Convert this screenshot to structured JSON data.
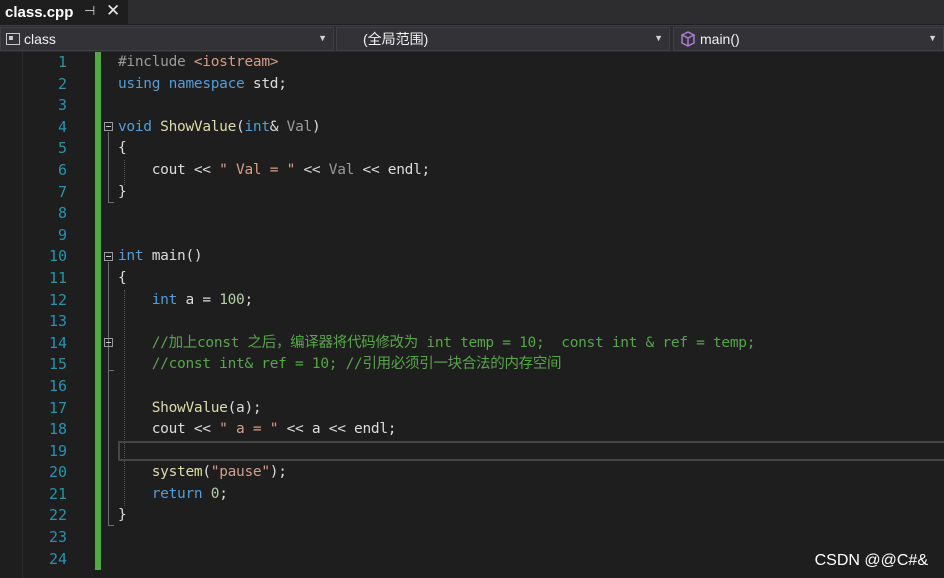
{
  "tab": {
    "title": "class.cpp",
    "pin_glyph": "⊣",
    "close_glyph": "✕"
  },
  "navbar": {
    "scope": "class",
    "range": "(全局范围)",
    "function": "main()",
    "icons": {
      "scope": "class-icon",
      "function": "method-cube-icon"
    }
  },
  "editor": {
    "line_numbers": [
      "1",
      "2",
      "3",
      "4",
      "5",
      "6",
      "7",
      "8",
      "9",
      "10",
      "11",
      "12",
      "13",
      "14",
      "15",
      "16",
      "17",
      "18",
      "19",
      "20",
      "21",
      "22",
      "23",
      "24"
    ],
    "lines": [
      {
        "num": "1"
      },
      {
        "num": "2"
      }
    ],
    "current_line": 19
  },
  "code": {
    "l1": {
      "pp": "#include ",
      "inc": "<iostream>"
    },
    "l2": {
      "kw1": "using",
      "kw2": "namespace",
      "rest": " std;"
    },
    "l4": {
      "kw": "void",
      "fn": "ShowValue",
      "open": "(",
      "kw2": "int",
      "amp": "& ",
      "par": "Val",
      "close": ")"
    },
    "l5": "{",
    "l6": {
      "a": "    cout << ",
      "s": "\" Val = \"",
      "b": " << ",
      "v": "Val",
      "c": " << endl;"
    },
    "l7": "}",
    "l10": {
      "kw": "int",
      "rest": " main()"
    },
    "l11": "{",
    "l12": {
      "indent": "    ",
      "kw": "int",
      "a": " a = ",
      "n": "100",
      "end": ";"
    },
    "l14": "    //加上const 之后，编译器将代码修改为 int temp = 10;  const int & ref = temp;",
    "l15": "    //const int& ref = 10; //引用必须引一块合法的内存空间",
    "l17": {
      "indent": "    ",
      "fn": "ShowValue",
      "rest": "(a);"
    },
    "l18": {
      "a": "    cout << ",
      "s": "\" a = \"",
      "c": " << a << endl;"
    },
    "l20": {
      "indent": "    ",
      "fn": "system",
      "o": "(",
      "s": "\"pause\"",
      "c": ");"
    },
    "l21": {
      "indent": "    ",
      "kw": "return",
      "n": " 0",
      "c": ";"
    },
    "l22": "}"
  },
  "watermark": "CSDN @@C#&",
  "colors": {
    "background": "#1e1e1e",
    "keyword": "#569cd6",
    "comment": "#57a64a",
    "string": "#d69d85",
    "line_number": "#2b91af",
    "change_bar": "#57a64a"
  }
}
